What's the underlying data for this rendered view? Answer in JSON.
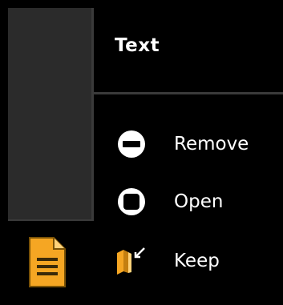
{
  "header": {
    "title": "Text"
  },
  "menu": {
    "items": [
      {
        "label": "Remove",
        "icon": "minus-circle-icon"
      },
      {
        "label": "Open",
        "icon": "open-square-icon"
      },
      {
        "label": "Keep",
        "icon": "keep-book-icon"
      }
    ]
  },
  "side_icon": {
    "icon": "text-document-icon",
    "color": "#f5a623"
  },
  "colors": {
    "background": "#000000",
    "panel": "#2b2b2b",
    "separator": "#3a3a3a",
    "accent": "#f5a623"
  }
}
